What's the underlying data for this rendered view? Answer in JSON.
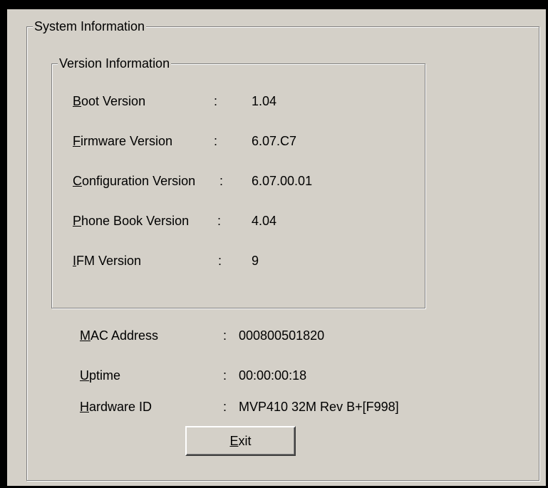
{
  "system_group": {
    "title": "System Information"
  },
  "version_group": {
    "title": "Version Information",
    "rows": [
      {
        "acc": "B",
        "rest": "oot Version",
        "sep": ":",
        "value": "1.04"
      },
      {
        "acc": "F",
        "rest": "irmware Version",
        "sep": ":",
        "value": "6.07.C7"
      },
      {
        "acc": "C",
        "rest": "onfiguration Version",
        "sep": ":",
        "value": "6.07.00.01"
      },
      {
        "acc": "P",
        "rest": "hone Book Version",
        "sep": ":",
        "value": "4.04"
      },
      {
        "acc": "I",
        "rest": "FM Version",
        "sep": ":",
        "value": "9"
      }
    ]
  },
  "info_rows": [
    {
      "acc": "M",
      "rest": "AC Address",
      "sep": ":",
      "value": "000800501820"
    },
    {
      "acc": "U",
      "rest": "ptime",
      "sep": ":",
      "value": "00:00:00:18"
    },
    {
      "acc": "H",
      "rest": "ardware ID",
      "sep": ":",
      "value": "MVP410 32M Rev B+[F998]"
    }
  ],
  "exit_button": {
    "acc": "E",
    "rest": "xit"
  }
}
